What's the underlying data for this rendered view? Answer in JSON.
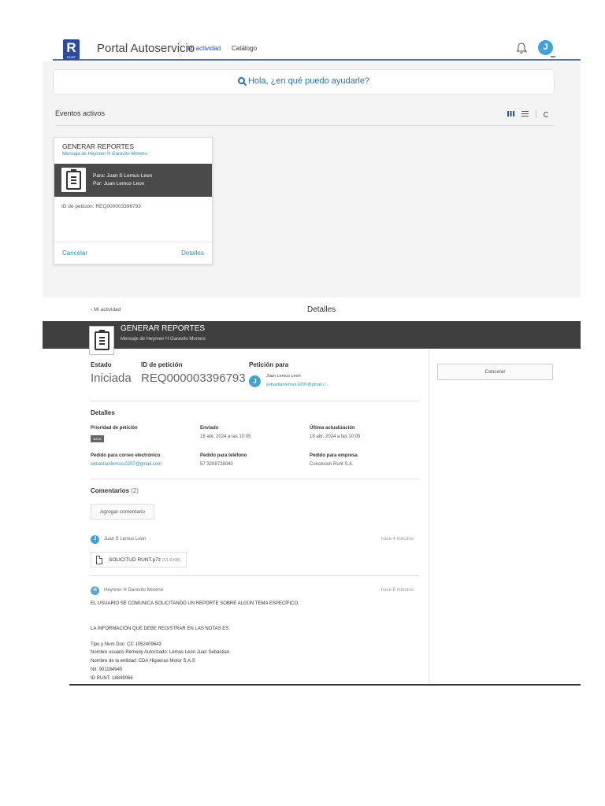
{
  "portal": {
    "logo_letter": "R",
    "logo_caption": "RUNT",
    "title": "Portal Autoservicio",
    "tabs": [
      {
        "label": "Mi actividad",
        "active": true
      },
      {
        "label": "Catálogo",
        "active": false
      }
    ],
    "user_initial": "J",
    "accent_color": "#2e4a9e"
  },
  "search": {
    "placeholder": "Hola, ¿en qué puedo ayudarle?"
  },
  "events": {
    "title": "Eventos activos",
    "card": {
      "title": "GENERAR REPORTES",
      "subtitle": "Mensaje de Heynner H Garavito Moreno",
      "para": "Para: Juan S Lemus Leon",
      "por": "Por: Juan Lemus Leon",
      "request_id": "ID de petición: REQ000003396793",
      "cancel_label": "Cancelar",
      "details_label": "Detalles"
    }
  },
  "detail": {
    "back_label": "‹ Mi actividad",
    "heading": "Detalles",
    "band_title": "GENERAR REPORTES",
    "band_subtitle": "Mensaje de Heynner H Garavito Moreno",
    "estado_label": "Estado",
    "estado_value": "Iniciada",
    "id_label": "ID de petición",
    "id_value": "REQ000003396793",
    "peticion_para_label": "Petición para",
    "peticion_para_initial": "J",
    "peticion_para_name": "Juan Lemus Leon",
    "peticion_para_email": "sebastianlemus.0297@gmail.c...",
    "cancel_button": "Cancelar",
    "details_title": "Detalles",
    "fields": {
      "prioridad_label": "Prioridad de petición",
      "prioridad_value": "BAJA",
      "enviado_label": "Enviado",
      "enviado_value": "18 abr. 2024 a las 10:05",
      "ultima_label": "Última actualización",
      "ultima_value": "18 abr. 2024 a las 10:05",
      "correo_label": "Pedido para correo electrónico",
      "correo_value": "sebastianlemus.0297@gmail.com",
      "telefono_label": "Pedido para teléfono",
      "telefono_value": "57 3208728040",
      "empresa_label": "Pedido para empresa",
      "empresa_value": "Concesion Runt S.A."
    },
    "comments_title": "Comentarios",
    "comments_count": "(2)",
    "add_comment_label": "Agregar comentario",
    "comments": [
      {
        "initial": "J",
        "author": "Juan S Lemus Leon",
        "time": "hace 4 minutos",
        "attachment_name": "SOLICITUD RUNT.p7z",
        "attachment_size": "(61.9 KB)"
      },
      {
        "initial": "H",
        "author": "Heynner H Garavito Moreno",
        "time": "hace 6 minutos",
        "lines": [
          "EL USUARIO SE COMUNICA SOLICITANDO UN REPORTE SOBRE ALGÚN TEMA ESPECÍFICO.",
          "LA INFORMACIÓN QUE DEBE REGISTRAR EN LAS NOTAS ES:",
          "Tipo y Num Doc: CC 1052409643",
          "Nombre usuario Remedy Autorizado: Lemus Leon Juan Sebastian",
          "Nombre de la entidad: CDA Higueras Motor S.A.S",
          "Nit: 901184945",
          "ID RUNT: 18849066"
        ]
      }
    ]
  }
}
